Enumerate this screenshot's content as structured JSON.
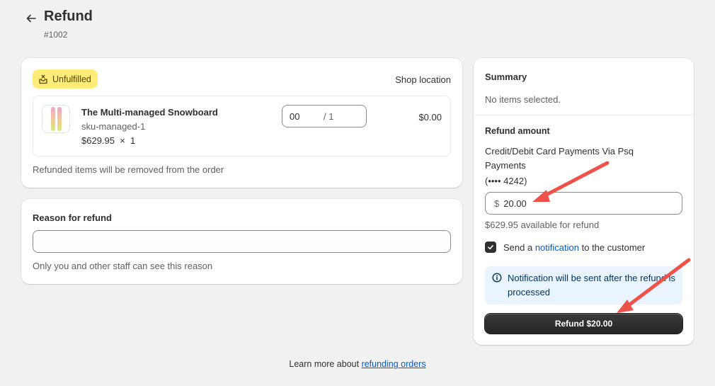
{
  "header": {
    "back_icon": "arrow-left-icon",
    "title": "Refund",
    "order_number": "#1002"
  },
  "items_card": {
    "badge": {
      "icon": "fulfillment-box-icon",
      "label": "Unfulfilled",
      "color": "#ffeb78"
    },
    "location": "Shop location",
    "line_items": [
      {
        "name": "The Multi-managed Snowboard",
        "sku": "sku-managed-1",
        "price_qty": "$629.95  ×  1",
        "refund_qty_value": "00",
        "refund_qty_max": "/ 1",
        "line_total": "$0.00"
      }
    ],
    "note": "Refunded items will be removed from the order"
  },
  "reason_card": {
    "label": "Reason for refund",
    "value": "",
    "help": "Only you and other staff can see this reason"
  },
  "summary_card": {
    "title": "Summary",
    "empty_text": "No items selected.",
    "refund_amount_title": "Refund amount",
    "payment_method": "Credit/Debit Card Payments Via Psq Payments",
    "card_mask": "(•••• 4242)",
    "currency_symbol": "$",
    "amount_value": "20.00",
    "available_text": "$629.95 available for refund",
    "notify": {
      "checked": true,
      "prefix": "Send a",
      "link": "notification",
      "suffix": "to the customer"
    },
    "info_banner": {
      "icon": "info-icon",
      "text": "Notification will be sent after the refund is processed"
    },
    "refund_button": "Refund $20.00"
  },
  "footer": {
    "prefix": "Learn more about",
    "link": "refunding orders"
  },
  "colors": {
    "accent_link": "#005bd3",
    "annotation_arrow": "#f0524a",
    "primary_button": "#303030",
    "info_bg": "#eaf4ff"
  }
}
